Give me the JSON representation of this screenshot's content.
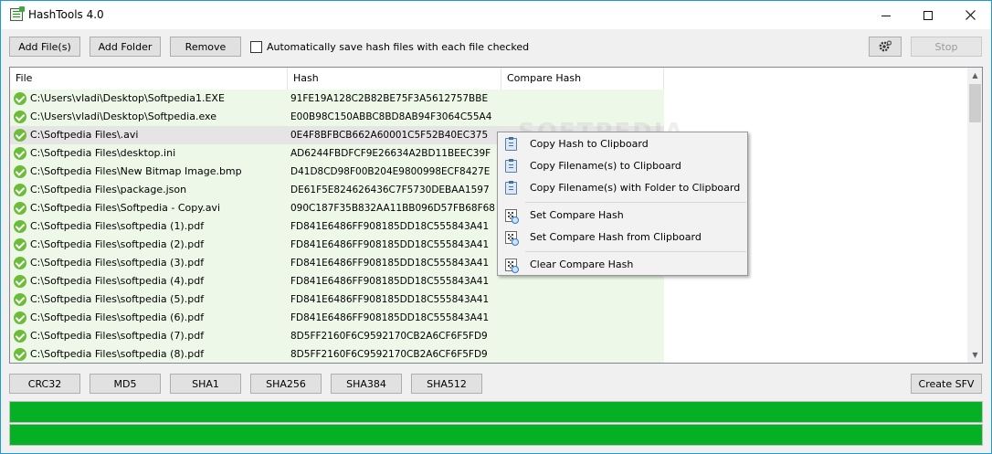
{
  "window": {
    "title": "HashTools 4.0"
  },
  "toolbar": {
    "add_files": "Add File(s)",
    "add_folder": "Add Folder",
    "remove": "Remove",
    "auto_save_label": "Automatically save hash files with each file checked",
    "auto_save_checked": false,
    "settings_icon": "gear-icon",
    "stop": "Stop"
  },
  "list": {
    "columns": [
      "File",
      "Hash",
      "Compare Hash"
    ],
    "rows": [
      {
        "file": "C:\\Users\\vladi\\Desktop\\Softpedia1.EXE",
        "hash": "91FE19A128C2B82BE75F3A5612757BBE"
      },
      {
        "file": "C:\\Users\\vladi\\Desktop\\Softpedia.exe",
        "hash": "E00B98C150ABBC8BD8AB94F3064C55A4"
      },
      {
        "file": "C:\\Softpedia Files\\.avi",
        "hash": "0E4F8BFBCB662A60001C5F52B40EC375"
      },
      {
        "file": "C:\\Softpedia Files\\desktop.ini",
        "hash": "AD6244FBDFCF9E26634A2BD11BEEC39F"
      },
      {
        "file": "C:\\Softpedia Files\\New Bitmap Image.bmp",
        "hash": "D41D8CD98F00B204E9800998ECF8427E"
      },
      {
        "file": "C:\\Softpedia Files\\package.json",
        "hash": "DE61F5E824626436C7F5730DEBAA1597"
      },
      {
        "file": "C:\\Softpedia Files\\Softpedia - Copy.avi",
        "hash": "090C187F35B832AA11BB096D57FB68F68"
      },
      {
        "file": "C:\\Softpedia Files\\softpedia (1).pdf",
        "hash": "FD841E6486FF908185DD18C555843A41"
      },
      {
        "file": "C:\\Softpedia Files\\softpedia (2).pdf",
        "hash": "FD841E6486FF908185DD18C555843A41"
      },
      {
        "file": "C:\\Softpedia Files\\softpedia (3).pdf",
        "hash": "FD841E6486FF908185DD18C555843A41"
      },
      {
        "file": "C:\\Softpedia Files\\softpedia (4).pdf",
        "hash": "FD841E6486FF908185DD18C555843A41"
      },
      {
        "file": "C:\\Softpedia Files\\softpedia (5).pdf",
        "hash": "FD841E6486FF908185DD18C555843A41"
      },
      {
        "file": "C:\\Softpedia Files\\softpedia (6).pdf",
        "hash": "FD841E6486FF908185DD18C555843A41"
      },
      {
        "file": "C:\\Softpedia Files\\softpedia (7).pdf",
        "hash": "8D5FF2160F6C9592170CB2A6CF6F5FD9"
      },
      {
        "file": "C:\\Softpedia Files\\softpedia (8).pdf",
        "hash": "8D5FF2160F6C9592170CB2A6CF6F5FD9"
      }
    ],
    "selected_row": 2,
    "row_status_icon": "check-circle-icon",
    "watermark": "SOFTPEDIA"
  },
  "context_menu": {
    "items": [
      {
        "label": "Copy Hash to Clipboard",
        "icon": "clipboard-icon"
      },
      {
        "label": "Copy Filename(s) to Clipboard",
        "icon": "clipboard-icon"
      },
      {
        "label": "Copy Filename(s) with Folder to Clipboard",
        "icon": "clipboard-icon"
      },
      {
        "label": "Set Compare Hash",
        "icon": "hash-compare-icon"
      },
      {
        "label": "Set Compare Hash from Clipboard",
        "icon": "hash-compare-icon"
      },
      {
        "label": "Clear Compare Hash",
        "icon": "hash-compare-icon"
      }
    ]
  },
  "hash_buttons": [
    "CRC32",
    "MD5",
    "SHA1",
    "SHA256",
    "SHA384",
    "SHA512"
  ],
  "create_sfv": "Create SFV",
  "progress": {
    "bar1": 1.0,
    "bar2": 1.0
  },
  "colors": {
    "progress_green": "#06b025",
    "row_checked_bg": "#edf8e8",
    "accent_border": "#1a9cd6"
  }
}
